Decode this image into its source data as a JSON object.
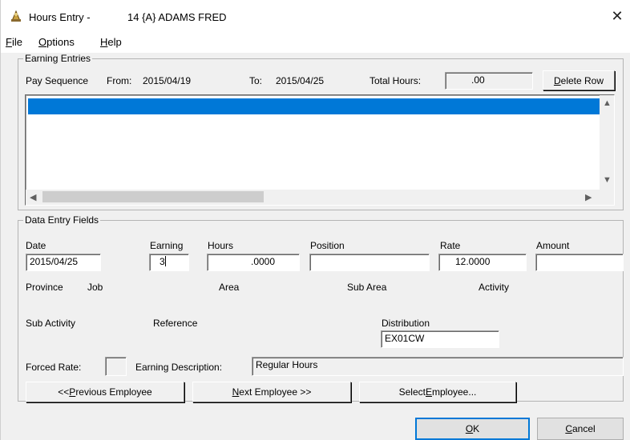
{
  "window": {
    "title": "Hours Entry -",
    "employee": "14 {A} ADAMS FRED",
    "close_glyph": "✕"
  },
  "menu": [
    {
      "label_u": "F",
      "label_rest": "ile"
    },
    {
      "label_u": "O",
      "label_rest": "ptions"
    },
    {
      "label_u": "H",
      "label_rest": "elp"
    }
  ],
  "earning_entries": {
    "group_title": "Earning Entries",
    "pay_sequence_label": "Pay Sequence",
    "from_label": "From:",
    "from_value": "2015/04/19",
    "to_label": "To:",
    "to_value": "2015/04/25",
    "total_hours_label": "Total Hours:",
    "total_hours_value": ".00",
    "delete_row_u": "D",
    "delete_row_rest": "elete Row"
  },
  "data_entry": {
    "group_title": "Data Entry Fields",
    "labels": {
      "date": "Date",
      "earning": "Earning",
      "hours": "Hours",
      "position": "Position",
      "rate": "Rate",
      "amount": "Amount",
      "province": "Province",
      "job": "Job",
      "area": "Area",
      "sub_area": "Sub Area",
      "activity": "Activity",
      "sub_activity": "Sub Activity",
      "reference": "Reference",
      "distribution": "Distribution",
      "forced_rate": "Forced Rate:",
      "earning_description": "Earning Description:"
    },
    "values": {
      "date": "2015/04/25",
      "earning": "3",
      "hours": ".0000",
      "position": "",
      "rate": "12.0000",
      "amount": "",
      "distribution": "EX01CW",
      "forced_rate": "",
      "earning_description": "Regular Hours"
    }
  },
  "buttons": {
    "prev_pre": "<< ",
    "prev_u": "P",
    "prev_rest": "revious Employee",
    "next_u": "N",
    "next_rest": "ext Employee >>",
    "select_pre": "Select ",
    "select_u": "E",
    "select_rest": "mployee...",
    "ok_u": "O",
    "ok_rest": "K",
    "cancel_u": "C",
    "cancel_rest": "ancel"
  },
  "icons": {
    "app": "hours-entry-icon",
    "close": "close-icon",
    "scroll_up": "▲",
    "scroll_down": "▼",
    "scroll_left": "◀",
    "scroll_right": "▶"
  }
}
